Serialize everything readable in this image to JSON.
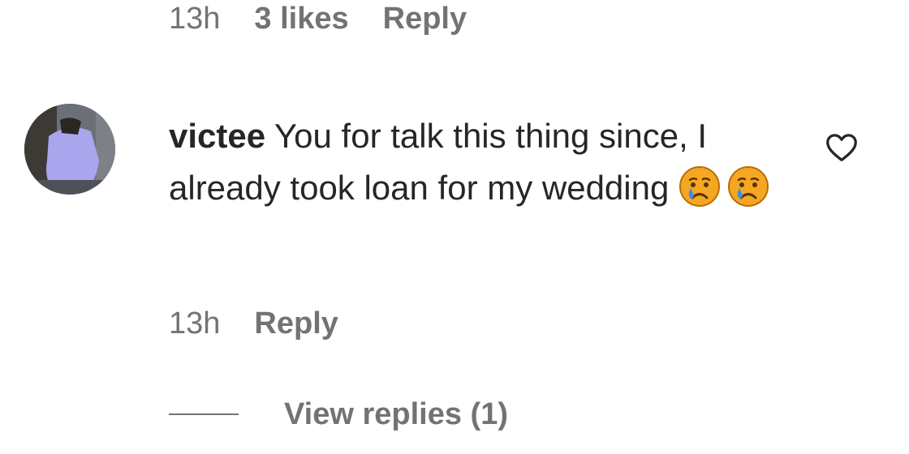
{
  "previous_comment": {
    "time": "13h",
    "likes": "3 likes",
    "reply_label": "Reply"
  },
  "comment": {
    "username": "victee",
    "text_line": "You for talk this thing since, I already took loan for my wedding",
    "emojis": [
      "crying-face",
      "crying-face"
    ],
    "time": "13h",
    "reply_label": "Reply"
  },
  "view_replies": {
    "label": "View replies (1)"
  },
  "icons": {
    "like": "heart-outline-icon"
  },
  "colors": {
    "text": "#262626",
    "secondary": "#737373",
    "emoji_face": "#f5a623"
  }
}
